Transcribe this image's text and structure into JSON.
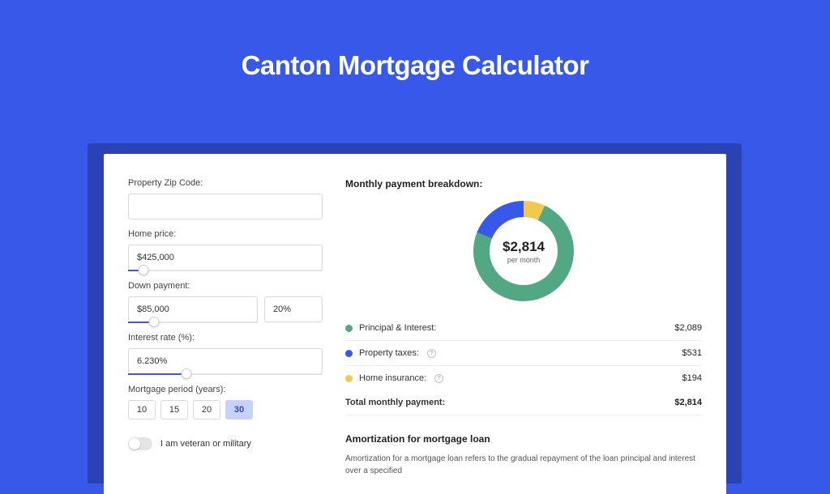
{
  "title": "Canton Mortgage Calculator",
  "colors": {
    "background": "#3858e9",
    "principal": "#52a882",
    "taxes": "#3858e9",
    "insurance": "#f2c94c"
  },
  "form": {
    "zip_label": "Property Zip Code:",
    "zip_value": "",
    "home_price_label": "Home price:",
    "home_price_value": "$425,000",
    "home_price_slider_pct": 8,
    "down_payment_label": "Down payment:",
    "down_payment_value": "$85,000",
    "down_payment_pct_value": "20%",
    "down_payment_slider_pct": 20,
    "interest_label": "Interest rate (%):",
    "interest_value": "6.230%",
    "interest_slider_pct": 30,
    "period_label": "Mortgage period (years):",
    "period_options": [
      "10",
      "15",
      "20",
      "30"
    ],
    "period_selected": "30",
    "veteran_label": "I am veteran or military",
    "veteran_on": false
  },
  "breakdown": {
    "title": "Monthly payment breakdown:",
    "donut_amount": "$2,814",
    "donut_sub": "per month",
    "rows": [
      {
        "label": "Principal & Interest:",
        "value": "$2,089",
        "color": "g",
        "help": false
      },
      {
        "label": "Property taxes:",
        "value": "$531",
        "color": "b",
        "help": true
      },
      {
        "label": "Home insurance:",
        "value": "$194",
        "color": "y",
        "help": true
      }
    ],
    "total_label": "Total monthly payment:",
    "total_value": "$2,814"
  },
  "amortization": {
    "title": "Amortization for mortgage loan",
    "body": "Amortization for a mortgage loan refers to the gradual repayment of the loan principal and interest over a specified"
  },
  "chart_data": {
    "type": "pie",
    "title": "Monthly payment breakdown",
    "categories": [
      "Principal & Interest",
      "Property taxes",
      "Home insurance"
    ],
    "values": [
      2089,
      531,
      194
    ],
    "total": 2814,
    "colors": [
      "#52a882",
      "#3858e9",
      "#f2c94c"
    ]
  }
}
